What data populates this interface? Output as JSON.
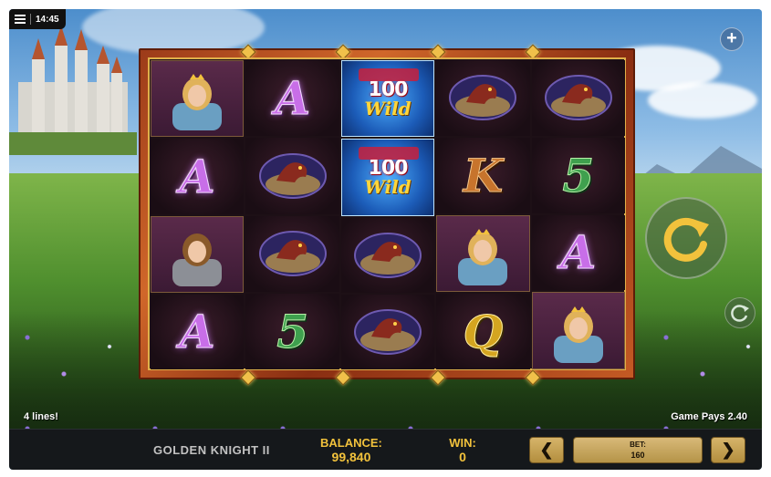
{
  "status_bar": {
    "time": "14:45"
  },
  "reels": [
    [
      {
        "symbol": "princess",
        "label": ""
      },
      {
        "symbol": "letter-a",
        "label": "A"
      },
      {
        "symbol": "knight",
        "label": ""
      },
      {
        "symbol": "letter-a",
        "label": "A"
      }
    ],
    [
      {
        "symbol": "letter-a",
        "label": "A"
      },
      {
        "symbol": "dragon",
        "label": ""
      },
      {
        "symbol": "dragon",
        "label": ""
      },
      {
        "symbol": "letter-5",
        "label": "5"
      }
    ],
    [
      {
        "symbol": "wild",
        "label": "100",
        "sub": "Wild"
      },
      {
        "symbol": "wild",
        "label": "100",
        "sub": "Wild"
      },
      {
        "symbol": "dragon",
        "label": ""
      },
      {
        "symbol": "dragon",
        "label": ""
      }
    ],
    [
      {
        "symbol": "dragon",
        "label": ""
      },
      {
        "symbol": "letter-k",
        "label": "K"
      },
      {
        "symbol": "princess",
        "label": ""
      },
      {
        "symbol": "letter-q",
        "label": "Q"
      }
    ],
    [
      {
        "symbol": "dragon",
        "label": ""
      },
      {
        "symbol": "letter-5",
        "label": "5"
      },
      {
        "symbol": "letter-a",
        "label": "A"
      },
      {
        "symbol": "princess",
        "label": ""
      }
    ]
  ],
  "hud": {
    "lines_text": "4 lines!",
    "pays_text": "Game Pays 2.40"
  },
  "bottom_bar": {
    "game_title": "GOLDEN KNIGHT II",
    "balance_label": "BALANCE:",
    "balance_value": "99,840",
    "win_label": "WIN:",
    "win_value": "0",
    "bet_label": "BET:",
    "bet_value": "160",
    "prev_label": "❮",
    "next_label": "❯"
  },
  "buttons": {
    "plus_label": "+"
  },
  "colors": {
    "accent_gold": "#f2c23c",
    "frame_copper": "#c45a24",
    "bar_bg": "#15181b"
  }
}
